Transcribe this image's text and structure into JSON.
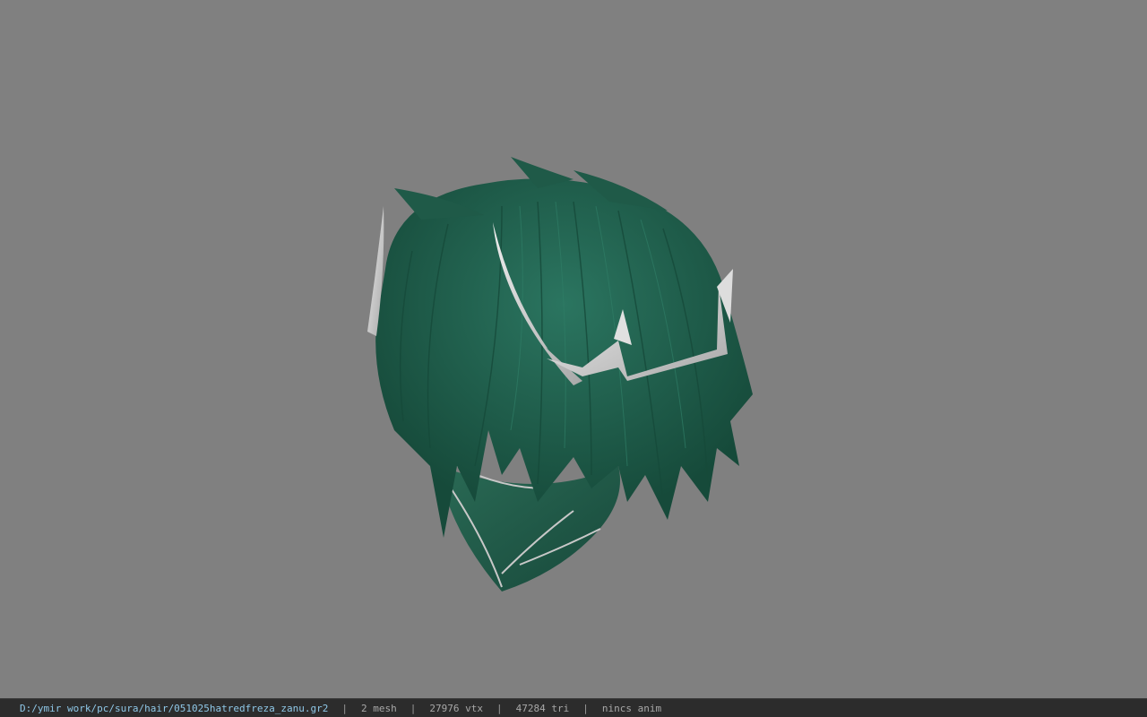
{
  "viewport": {
    "background_color": "#808080",
    "model": {
      "hair_color": "#1f5a48",
      "hair_highlight": "#2b7560",
      "accessory_color": "#d4d4d4",
      "mask_color": "#215a46"
    }
  },
  "statusbar": {
    "file_path": "D:/ymir work/pc/sura/hair/051025hatredfreza_zanu.gr2",
    "separator": "|",
    "mesh_count": "2 mesh",
    "vertex_count": "27976 vtx",
    "triangle_count": "47284 tri",
    "anim_status": "nincs anim",
    "path_color": "#8fc8e8"
  }
}
